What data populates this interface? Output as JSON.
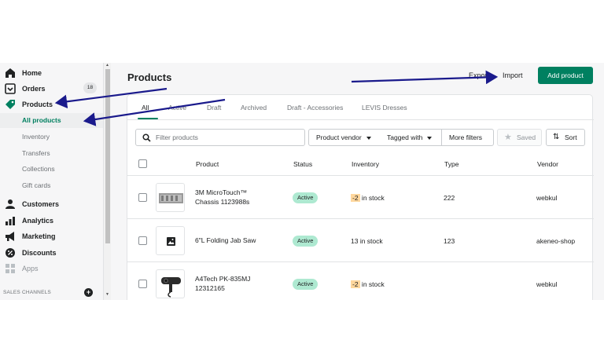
{
  "sidebar": {
    "home": "Home",
    "orders": "Orders",
    "orders_badge": "18",
    "products": "Products",
    "all_products": "All products",
    "inventory": "Inventory",
    "transfers": "Transfers",
    "collections": "Collections",
    "gift_cards": "Gift cards",
    "customers": "Customers",
    "analytics": "Analytics",
    "marketing": "Marketing",
    "discounts": "Discounts",
    "apps": "Apps",
    "sales_channels": "SALES CHANNELS"
  },
  "header": {
    "title": "Products",
    "export": "Export",
    "import": "Import",
    "add_product": "Add product"
  },
  "tabs": [
    "All",
    "Active",
    "Draft",
    "Archived",
    "Draft - Accessories",
    "LEVIS Dresses"
  ],
  "filters": {
    "search_placeholder": "Filter products",
    "product_vendor": "Product vendor",
    "tagged_with": "Tagged with",
    "more_filters": "More filters",
    "saved": "Saved",
    "sort": "Sort"
  },
  "columns": {
    "product": "Product",
    "status": "Status",
    "inventory": "Inventory",
    "type": "Type",
    "vendor": "Vendor"
  },
  "rows": [
    {
      "name": "3M MicroTouch™ Chassis 1123988s",
      "status": "Active",
      "inventory_warn": "-2",
      "inventory_text": " in stock",
      "type": "222",
      "vendor": "webkul"
    },
    {
      "name": "6\"L Folding Jab Saw",
      "status": "Active",
      "inventory_warn": "",
      "inventory_text": "13 in stock",
      "type": "123",
      "vendor": "akeneo-shop"
    },
    {
      "name": "A4Tech PK-835MJ 12312165",
      "status": "Active",
      "inventory_warn": "-2",
      "inventory_text": " in stock",
      "type": "",
      "vendor": "webkul"
    }
  ],
  "colors": {
    "accent": "#008060",
    "annotation_arrow": "#1a1a8c",
    "active_badge": "#aee9d1",
    "warning": "#ffd79d"
  }
}
